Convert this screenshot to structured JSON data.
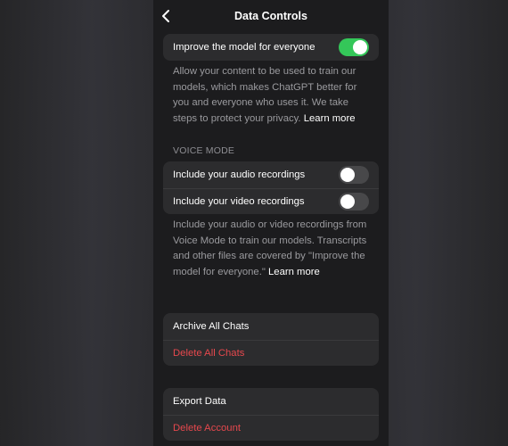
{
  "nav": {
    "title": "Data Controls"
  },
  "improve": {
    "label": "Improve the model for everyone",
    "enabled": true,
    "description": "Allow your content to be used to train our models, which makes ChatGPT better for you and everyone who uses it. We take steps to protect your privacy.",
    "learn_more": "Learn more"
  },
  "voice_mode": {
    "header": "VOICE MODE",
    "audio_label": "Include your audio recordings",
    "audio_enabled": false,
    "video_label": "Include your video recordings",
    "video_enabled": false,
    "description": "Include your audio or video recordings from Voice Mode to train our models. Transcripts and other files are covered by \"Improve the model for everyone.\"",
    "learn_more": "Learn more"
  },
  "chats": {
    "archive_label": "Archive All Chats",
    "delete_label": "Delete All Chats"
  },
  "account": {
    "export_label": "Export Data",
    "delete_label": "Delete Account"
  },
  "colors": {
    "toggle_on": "#34c759",
    "danger": "#e5484d"
  }
}
